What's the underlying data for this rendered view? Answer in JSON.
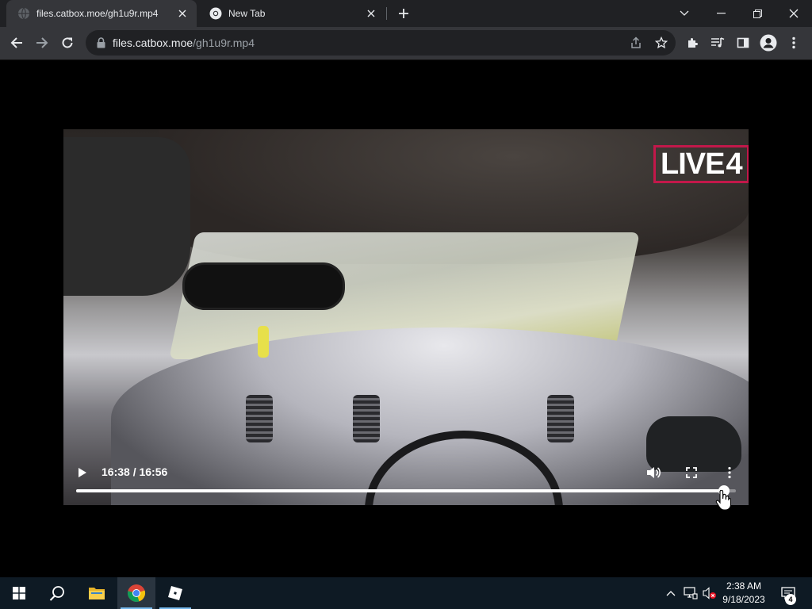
{
  "browser": {
    "tabs": [
      {
        "title": "files.catbox.moe/gh1u9r.mp4",
        "favicon": "globe-icon",
        "active": true
      },
      {
        "title": "New Tab",
        "favicon": "chrome-icon",
        "active": false
      }
    ],
    "omnibox": {
      "host": "files.catbox.moe",
      "path": "/gh1u9r.mp4"
    }
  },
  "video": {
    "watermark_brand": "LIVE",
    "watermark_number": "4",
    "current_time": "16:38",
    "duration": "16:56",
    "time_display": "16:38 / 16:56",
    "progress_fraction": 0.982,
    "icons": [
      "play-icon",
      "volume-icon",
      "fullscreen-icon",
      "more-vert-icon"
    ]
  },
  "taskbar": {
    "pinned": [
      "windows-start-icon",
      "search-icon",
      "file-explorer-icon",
      "chrome-icon",
      "roblox-icon"
    ],
    "clock_time": "2:38 AM",
    "clock_date": "9/18/2023",
    "notification_count": "4"
  },
  "colors": {
    "tabstrip": "#202124",
    "toolbar": "#35363a",
    "live_logo_border": "#c2184a",
    "taskbar": "#0e1a24"
  }
}
